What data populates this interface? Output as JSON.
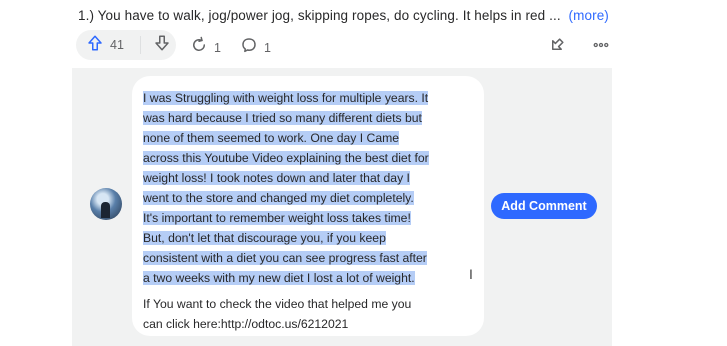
{
  "answer": {
    "snippet": "1.) You have to walk, jog/power jog, skipping ropes, do cycling. It helps in red ...",
    "more_label": "(more)"
  },
  "actions": {
    "upvote_count": "41",
    "share_count": "1",
    "comment_count": "1"
  },
  "comment": {
    "selected_lines": [
      "I was Struggling with weight loss for multiple years. It",
      "was hard because I tried so many different diets but",
      "none of them seemed to work. One day I Came",
      "across this Youtube Video explaining the best diet for",
      "weight loss! I took notes down and later that day I",
      "went to the store and changed my diet completely.",
      "It's important to remember weight loss takes time!",
      "But, don't let that discourage you, if you keep",
      "consistent with a diet you can see progress fast after",
      "a two weeks with my new diet I lost a lot of weight."
    ],
    "link_intro": "If You want to check the video that helped me you",
    "link_prefix": "can click here:",
    "link_url": "http://odtoc.us/6212021",
    "add_button_label": "Add Comment"
  },
  "icons": {
    "upvote": "upvote-arrow-icon",
    "downvote": "downvote-arrow-icon",
    "share": "reshare-icon",
    "comment": "comment-bubble-icon",
    "downvote_answer": "downvote-answer-icon",
    "more": "more-options-icon",
    "cursor": "text-cursor-icon"
  },
  "colors": {
    "accent": "#2e69ff",
    "selection": "#b5cdf6",
    "panel_bg": "#f1f2f2"
  }
}
